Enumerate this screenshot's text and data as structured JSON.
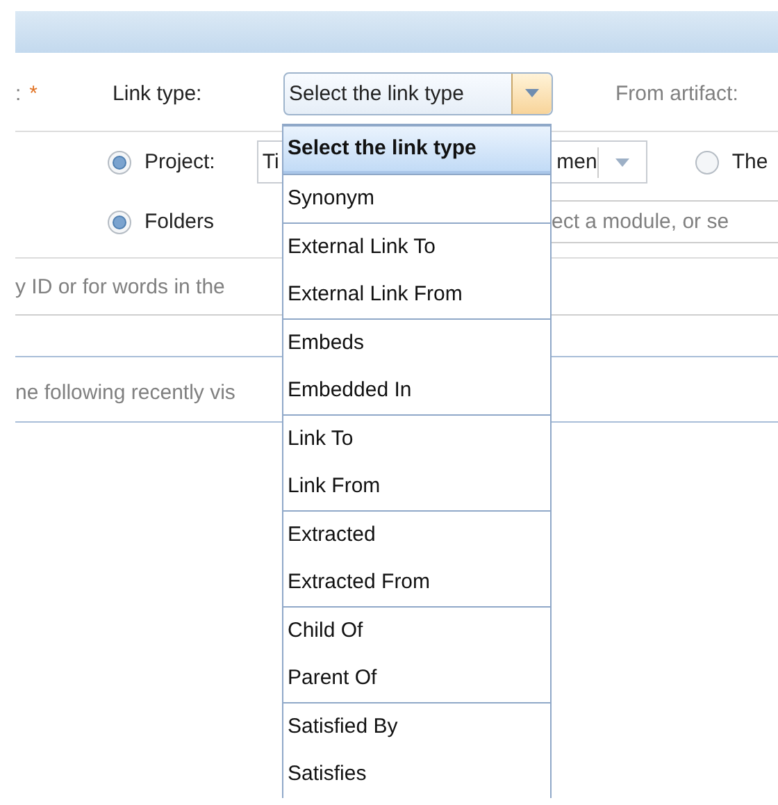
{
  "form": {
    "label_end": ":",
    "required_mark": "*",
    "link_type": {
      "label": "Link type:",
      "value": "Select the link type",
      "expanded": true
    },
    "from_artifact_label": "From artifact:",
    "scope_options": [
      {
        "kind": "project",
        "label": "Project:",
        "selected": true,
        "value_start": "Ti",
        "value_end": "men"
      },
      {
        "kind": "plain",
        "label": "The",
        "selected": false
      }
    ],
    "folders": {
      "label": "Folders",
      "selected": true,
      "placeholder": "ect a module, or se"
    },
    "search_hint": "y ID or for words in the",
    "recent_hint": "ne following recently vis"
  },
  "dropdown": {
    "groups": [
      {
        "items": [
          {
            "label": "Select the link type",
            "selected": true
          }
        ]
      },
      {
        "items": [
          {
            "label": "Synonym",
            "selected": false
          }
        ]
      },
      {
        "items": [
          {
            "label": "External Link To",
            "selected": false
          },
          {
            "label": "External Link From",
            "selected": false
          }
        ]
      },
      {
        "items": [
          {
            "label": "Embeds",
            "selected": false
          },
          {
            "label": "Embedded In",
            "selected": false
          }
        ]
      },
      {
        "items": [
          {
            "label": "Link To",
            "selected": false
          },
          {
            "label": "Link From",
            "selected": false
          }
        ]
      },
      {
        "items": [
          {
            "label": "Extracted",
            "selected": false
          },
          {
            "label": "Extracted From",
            "selected": false
          }
        ]
      },
      {
        "items": [
          {
            "label": "Child Of",
            "selected": false
          },
          {
            "label": "Parent Of",
            "selected": false
          }
        ]
      },
      {
        "items": [
          {
            "label": "Satisfied By",
            "selected": false
          },
          {
            "label": "Satisfies",
            "selected": false
          }
        ]
      }
    ]
  }
}
